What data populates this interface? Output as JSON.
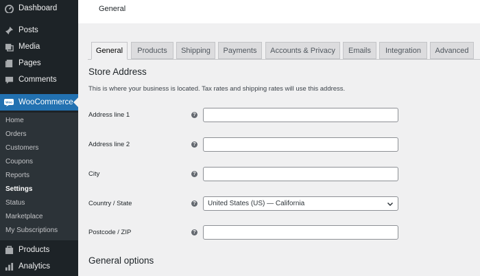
{
  "sidebar": {
    "items": [
      {
        "label": "Dashboard",
        "icon": "dashboard-icon"
      },
      {
        "label": "Posts",
        "icon": "pin-icon"
      },
      {
        "label": "Media",
        "icon": "media-icon"
      },
      {
        "label": "Pages",
        "icon": "pages-icon"
      },
      {
        "label": "Comments",
        "icon": "comment-icon"
      },
      {
        "label": "WooCommerce",
        "icon": "woocommerce-icon"
      },
      {
        "label": "Products",
        "icon": "products-icon"
      },
      {
        "label": "Analytics",
        "icon": "analytics-icon"
      }
    ],
    "woo_badge": "Woo",
    "submenu": [
      "Home",
      "Orders",
      "Customers",
      "Coupons",
      "Reports",
      "Settings",
      "Status",
      "Marketplace",
      "My Subscriptions"
    ],
    "current_submenu": "Settings",
    "active_color": "#2271b1"
  },
  "header": {
    "title": "General"
  },
  "tabs": [
    "General",
    "Products",
    "Shipping",
    "Payments",
    "Accounts & Privacy",
    "Emails",
    "Integration",
    "Advanced"
  ],
  "active_tab": "General",
  "store_address": {
    "heading": "Store Address",
    "description": "This is where your business is located. Tax rates and shipping rates will use this address.",
    "fields": [
      {
        "label": "Address line 1",
        "value": ""
      },
      {
        "label": "Address line 2",
        "value": ""
      },
      {
        "label": "City",
        "value": ""
      },
      {
        "label": "Country / State",
        "value": "United States (US) — California"
      },
      {
        "label": "Postcode / ZIP",
        "value": ""
      }
    ]
  },
  "general_options": {
    "heading": "General options"
  }
}
